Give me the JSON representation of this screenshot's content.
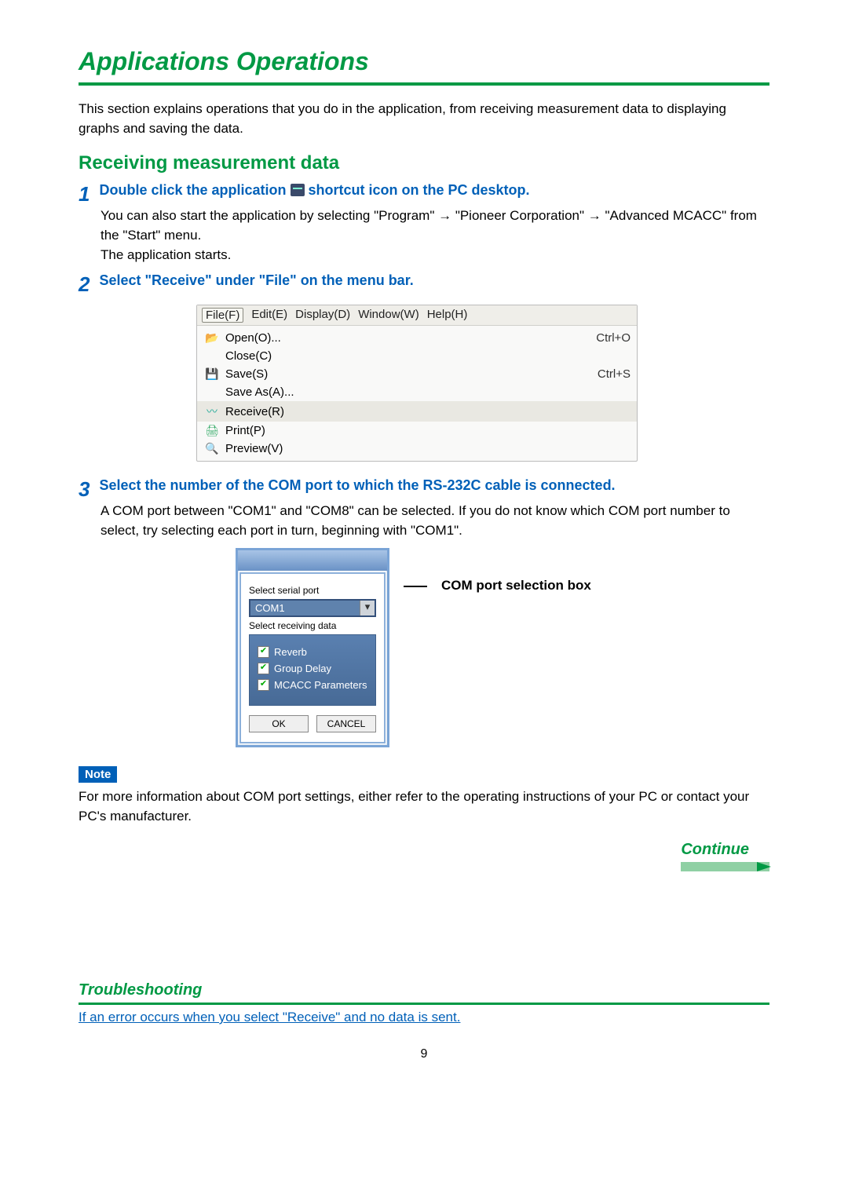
{
  "title": "Applications Operations",
  "intro": "This section explains operations that you do in the application, from receiving measurement data to displaying graphs and saving the data.",
  "section": "Receiving measurement data",
  "step1": {
    "num": "1",
    "head_a": "Double click the application ",
    "head_b": " shortcut icon on the PC desktop.",
    "body1a": "You can also start the application by selecting \"Program\" ",
    "body1b": " \"Pioneer Corporation\" ",
    "body1c": " \"Advanced MCACC\" from the \"Start\" menu.",
    "body2": "The application starts."
  },
  "step2": {
    "num": "2",
    "head": "Select \"Receive\" under \"File\" on the menu bar."
  },
  "menubar": {
    "file": "File(F)",
    "edit": "Edit(E)",
    "display": "Display(D)",
    "window": "Window(W)",
    "help": "Help(H)"
  },
  "menu": {
    "open": "Open(O)...",
    "open_sc": "Ctrl+O",
    "close": "Close(C)",
    "save": "Save(S)",
    "save_sc": "Ctrl+S",
    "saveas": "Save As(A)...",
    "receive": "Receive(R)",
    "print": "Print(P)",
    "preview": "Preview(V)"
  },
  "step3": {
    "num": "3",
    "head": "Select the number of the COM port to which the RS-232C cable is connected.",
    "body": "A COM port between \"COM1\" and \"COM8\" can be selected. If you do not know which COM port number to select, try selecting each port in turn, beginning with \"COM1\"."
  },
  "dialog": {
    "label1": "Select serial port",
    "combo": "COM1",
    "label2": "Select receiving data",
    "chk1": "Reverb",
    "chk2": "Group Delay",
    "chk3": "MCACC Parameters",
    "ok": "OK",
    "cancel": "CANCEL"
  },
  "callout": "COM port selection box",
  "note_label": "Note",
  "note_body": "For more information about COM port settings, either refer to the operating instructions of your PC or contact your PC's manufacturer.",
  "continue": "Continue",
  "ts_title": "Troubleshooting",
  "ts_link": "If an error occurs when you select \"Receive\" and no data is sent.",
  "page_number": "9",
  "arrow": "→"
}
